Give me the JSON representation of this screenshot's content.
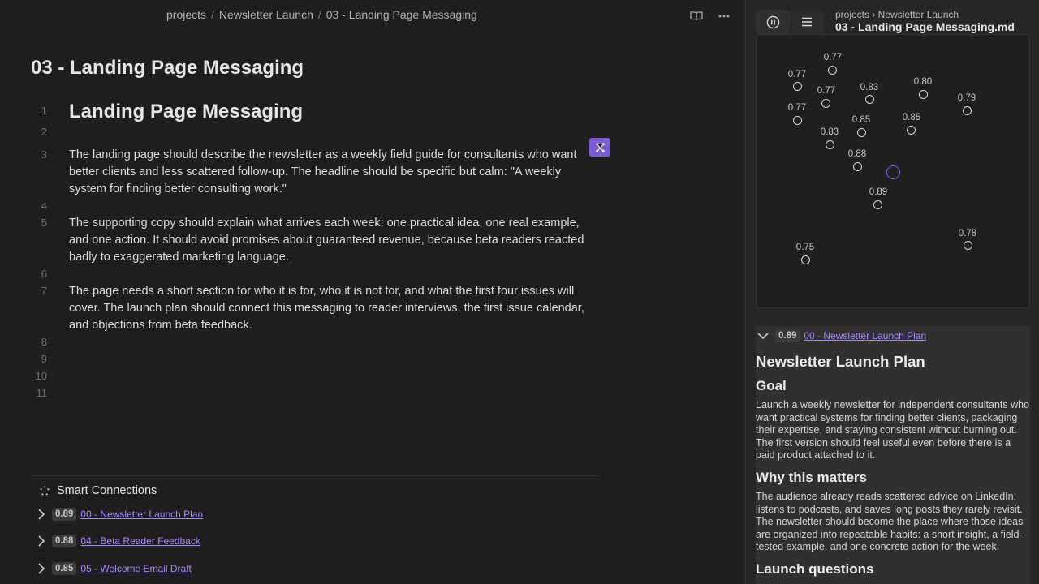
{
  "header": {
    "breadcrumb": [
      "projects",
      "Newsletter Launch",
      "03 - Landing Page Messaging"
    ],
    "separator": "/"
  },
  "editor": {
    "title": "03 - Landing Page Messaging",
    "lines": [
      {
        "num": "1",
        "text": "Landing Page Messaging",
        "kind": "h1"
      },
      {
        "num": "2",
        "text": ""
      },
      {
        "num": "3",
        "text": "The landing page should describe the newsletter as a weekly field guide for consultants who want better clients and less scattered follow-up. The headline should be specific but calm: \"A weekly system for finding better consulting work.\""
      },
      {
        "num": "4",
        "text": ""
      },
      {
        "num": "5",
        "text": "The supporting copy should explain what arrives each week: one practical idea, one real example, and one action. It should avoid promises about guaranteed revenue, because beta readers reacted badly to exaggerated marketing language."
      },
      {
        "num": "6",
        "text": ""
      },
      {
        "num": "7",
        "text": "The page needs a short section for who it is for, who it is not for, and what the first four issues will cover. The launch plan should connect this messaging to reader interviews, the first issue calendar, and objections from beta feedback."
      },
      {
        "num": "8",
        "text": ""
      },
      {
        "num": "9",
        "text": ""
      },
      {
        "num": "10",
        "text": ""
      },
      {
        "num": "11",
        "text": ""
      }
    ]
  },
  "smart_connections": {
    "title": "Smart Connections",
    "items": [
      {
        "score": "0.89",
        "label": "00 - Newsletter Launch Plan"
      },
      {
        "score": "0.88",
        "label": "04 - Beta Reader Feedback"
      },
      {
        "score": "0.85",
        "label": "05 - Welcome Email Draft"
      }
    ]
  },
  "right": {
    "path": "projects › Newsletter Launch",
    "file": "03 - Landing Page Messaging.md",
    "graph_nodes": [
      "0.77",
      "0.77",
      "0.77",
      "0.77",
      "0.83",
      "0.80",
      "0.79",
      "0.83",
      "0.85",
      "0.85",
      "0.88",
      "0.89",
      "0.75",
      "0.78"
    ],
    "preview": {
      "score": "0.89",
      "link": "00 - Newsletter Launch Plan",
      "h1": "Newsletter Launch Plan",
      "goal_heading": "Goal",
      "goal_text": "Launch a weekly newsletter for independent consultants who want practical systems for finding better clients, packaging their expertise, and staying consistent without burning out. The first version should feel useful even before there is a paid product attached to it.",
      "why_heading": "Why this matters",
      "why_text": "The audience already reads scattered advice on LinkedIn, listens to podcasts, and saves long posts they rarely revisit. The newsletter should become the place where those ideas are organized into repeatable habits: a short insight, a field-tested example, and one concrete action for the week.",
      "questions_heading": "Launch questions"
    }
  },
  "colors": {
    "accent": "#7c5cd6",
    "link": "#a88bfa"
  }
}
